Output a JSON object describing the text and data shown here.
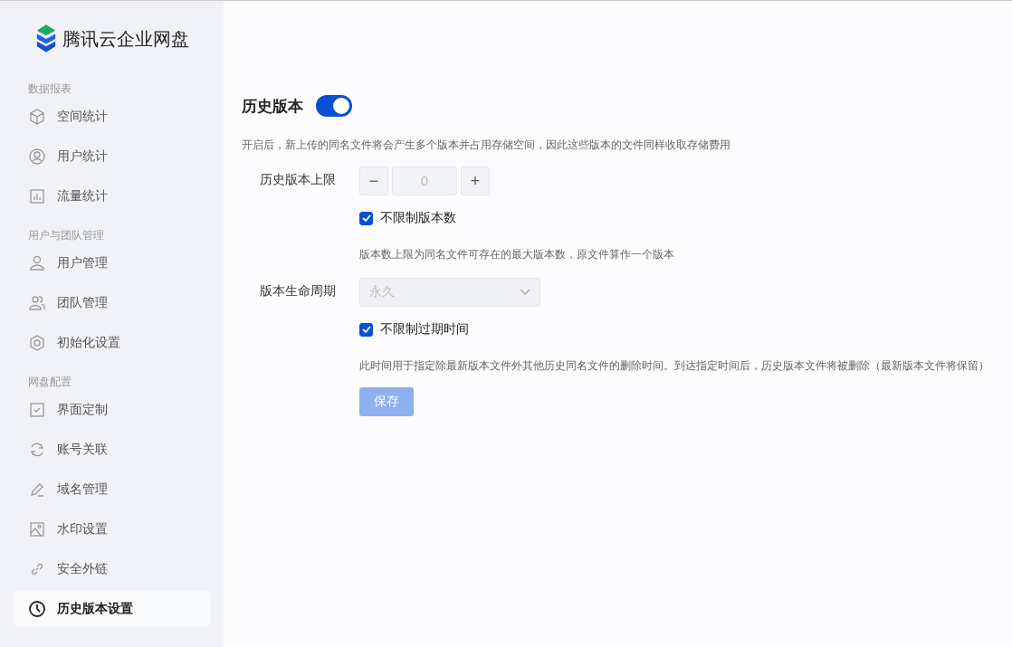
{
  "sidebar": {
    "logo": "腾讯云企业网盘",
    "sections": [
      {
        "label": "数据报表",
        "items": [
          {
            "label": "空间统计",
            "kind": "cube",
            "selected": false
          },
          {
            "label": "用户统计",
            "kind": "user-circle",
            "selected": false
          },
          {
            "label": "流量统计",
            "kind": "bar-chart",
            "selected": false
          }
        ]
      },
      {
        "label": "用户与团队管理",
        "items": [
          {
            "label": "用户管理",
            "kind": "user",
            "selected": false
          },
          {
            "label": "团队管理",
            "kind": "users",
            "selected": false
          },
          {
            "label": "初始化设置",
            "kind": "hexagon",
            "selected": false
          }
        ]
      },
      {
        "label": "网盘配置",
        "items": [
          {
            "label": "界面定制",
            "kind": "checkbox",
            "selected": false
          },
          {
            "label": "账号关联",
            "kind": "sync",
            "selected": false
          },
          {
            "label": "域名管理",
            "kind": "pencil",
            "selected": false
          },
          {
            "label": "水印设置",
            "kind": "image",
            "selected": false
          },
          {
            "label": "安全外链",
            "kind": "link",
            "selected": false
          },
          {
            "label": "历史版本设置",
            "kind": "clock",
            "selected": true
          }
        ]
      }
    ]
  },
  "main": {
    "title": "历史版本",
    "toggle_on": true,
    "description": "开启后，新上传的同名文件将会产生多个版本并占用存储空间，因此这些版本的文件同样收取存储费用",
    "version_limit": {
      "label": "历史版本上限",
      "minus": "−",
      "value": "0",
      "plus": "+",
      "disabled": true,
      "checkbox": {
        "label": "不限制版本数",
        "checked": true
      },
      "hint": "版本数上限为同名文件可存在的最大版本数，原文件算作一个版本"
    },
    "lifecycle": {
      "label": "版本生命周期",
      "value": "永久",
      "disabled": true,
      "checkbox": {
        "label": "不限制过期时间",
        "checked": true
      },
      "hint": "此时间用于指定除最新版本文件外其他历史同名文件的删除时间。到达指定时间后，历史版本文件将被删除（最新版本文件将保留）"
    },
    "save_button": {
      "label": "保存",
      "disabled": true
    }
  }
}
